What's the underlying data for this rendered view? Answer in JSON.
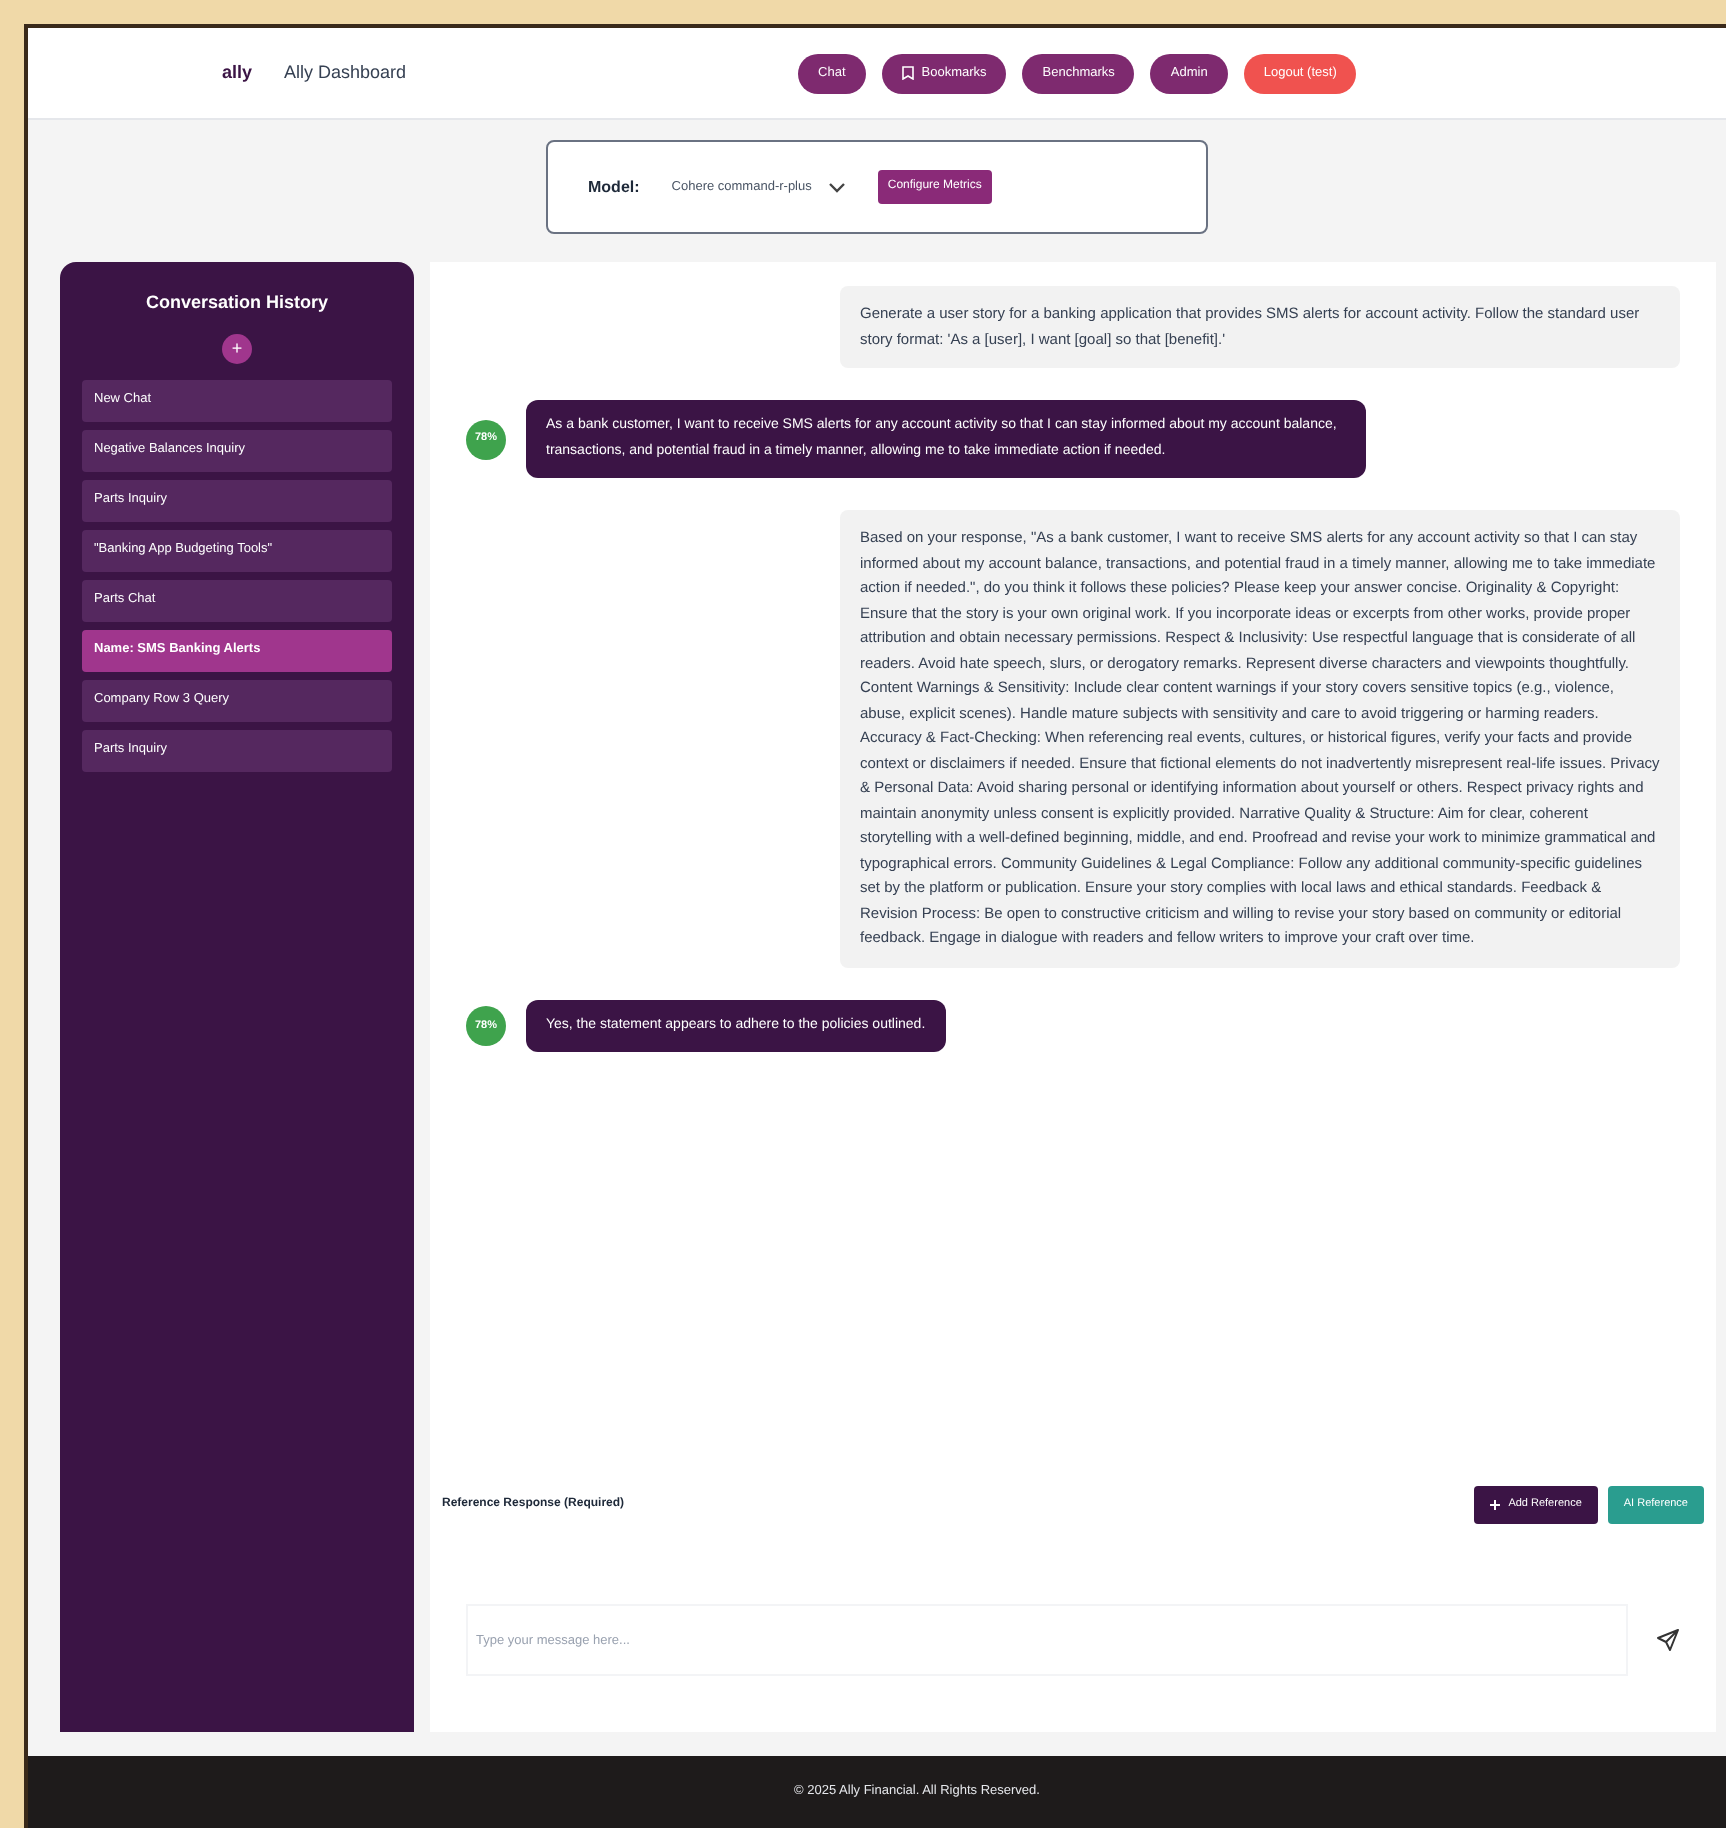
{
  "header": {
    "logo": "ally",
    "title": "Ally Dashboard",
    "nav": [
      {
        "label": "Chat",
        "kind": "nav"
      },
      {
        "label": "Bookmarks",
        "kind": "icon_nav"
      },
      {
        "label": "Benchmarks",
        "kind": "nav"
      },
      {
        "label": "Admin",
        "kind": "nav"
      },
      {
        "label": "Logout (test)",
        "kind": "logout"
      }
    ]
  },
  "model_bar": {
    "label": "Model:",
    "value": "Cohere command-r-plus",
    "button": "Configure Metrics"
  },
  "sidebar": {
    "title": "Conversation History",
    "new_button": "+",
    "items": [
      {
        "label": "New Chat",
        "selected": false
      },
      {
        "label": "Negative Balances Inquiry",
        "selected": false
      },
      {
        "label": "Parts Inquiry",
        "selected": false
      },
      {
        "label": "\"Banking App Budgeting Tools\"",
        "selected": false
      },
      {
        "label": "Parts Chat",
        "selected": false
      },
      {
        "label": "Name: SMS Banking Alerts",
        "selected": true
      },
      {
        "label": "Company Row 3 Query",
        "selected": false
      },
      {
        "label": "Parts Inquiry",
        "selected": false
      }
    ]
  },
  "messages": [
    {
      "kind": "user",
      "text": "Generate a user story for a banking application that provides SMS alerts for account activity. Follow the standard user story format: 'As a [user], I want [goal] so that [benefit].'"
    },
    {
      "kind": "bot",
      "avatar": "78%",
      "text": "As a bank customer, I want to receive SMS alerts for any account activity so that I can stay informed about my account balance, transactions, and potential fraud in a timely manner, allowing me to take immediate action if needed."
    },
    {
      "kind": "user",
      "text": "Based on your response, \"As a bank customer, I want to receive SMS alerts for any account activity so that I can stay informed about my account balance, transactions, and potential fraud in a timely manner, allowing me to take immediate action if needed.\", do you think it follows these policies? Please keep your answer concise. Originality & Copyright: Ensure that the story is your own original work. If you incorporate ideas or excerpts from other works, provide proper attribution and obtain necessary permissions. Respect & Inclusivity: Use respectful language that is considerate of all readers. Avoid hate speech, slurs, or derogatory remarks. Represent diverse characters and viewpoints thoughtfully. Content Warnings & Sensitivity: Include clear content warnings if your story covers sensitive topics (e.g., violence, abuse, explicit scenes). Handle mature subjects with sensitivity and care to avoid triggering or harming readers. Accuracy & Fact-Checking: When referencing real events, cultures, or historical figures, verify your facts and provide context or disclaimers if needed. Ensure that fictional elements do not inadvertently misrepresent real-life issues. Privacy & Personal Data: Avoid sharing personal or identifying information about yourself or others. Respect privacy rights and maintain anonymity unless consent is explicitly provided. Narrative Quality & Structure: Aim for clear, coherent storytelling with a well-defined beginning, middle, and end. Proofread and revise your work to minimize grammatical and typographical errors. Community Guidelines & Legal Compliance: Follow any additional community-specific guidelines set by the platform or publication. Ensure your story complies with local laws and ethical standards. Feedback & Revision Process: Be open to constructive criticism and willing to revise your story based on community or editorial feedback. Engage in dialogue with readers and fellow writers to improve your craft over time."
    },
    {
      "kind": "bot",
      "avatar": "78%",
      "text": "Yes, the statement appears to adhere to the policies outlined."
    }
  ],
  "reference": {
    "label": "Reference Response (Required)",
    "buttons": [
      {
        "label": "Add Reference",
        "kind": "add"
      },
      {
        "label": "AI Reference",
        "kind": "ai"
      }
    ]
  },
  "composer": {
    "placeholder": "Type your message here..."
  },
  "footer": "© 2025 Ally Financial. All Rights Reserved."
}
